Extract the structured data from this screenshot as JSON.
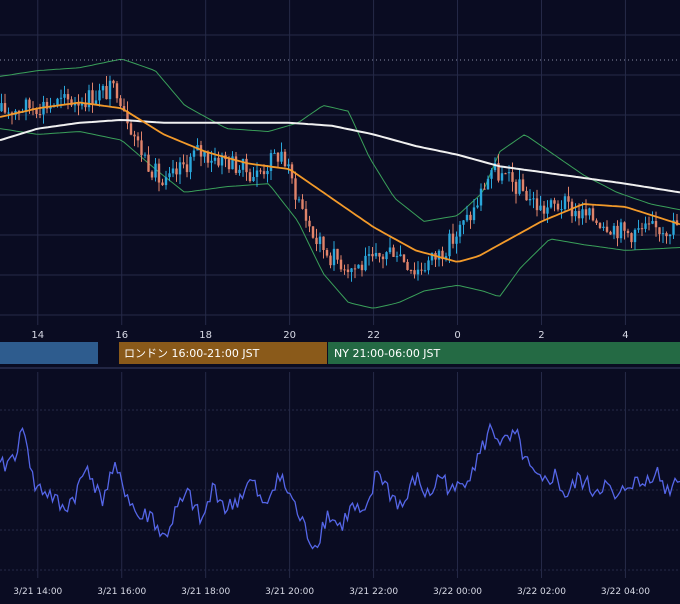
{
  "colors": {
    "background": "#0a0c22",
    "grid": "#262a48",
    "candle_up": "#2aa7dc",
    "candle_down": "#e0836a",
    "ma_fast": "#f39a2a",
    "ma_slow": "#f0f0f0",
    "bollinger": "#3aa05a",
    "oscillator": "#5566e8",
    "session_tokyo": "#2e5c8e",
    "session_london": "#8a5a1a",
    "session_ny": "#246a44"
  },
  "sessions": [
    {
      "id": "tokyo",
      "label": ""
    },
    {
      "id": "london",
      "label": "ロンドン 16:00-21:00 JST"
    },
    {
      "id": "ny",
      "label": "NY 21:00-06:00 JST"
    }
  ],
  "chart_data": [
    {
      "type": "candlestick",
      "x_ticks": [
        "14",
        "16",
        "18",
        "20",
        "22",
        "0",
        "2",
        "4"
      ],
      "x_tick_hours": [
        14,
        16,
        18,
        20,
        22,
        24,
        26,
        28
      ],
      "x_range_hours": [
        13.1,
        29.3
      ],
      "overlays": [
        "ma_fast",
        "ma_slow",
        "bollinger_upper",
        "bollinger_lower"
      ],
      "price_path": [
        [
          13.1,
          0.72
        ],
        [
          14.0,
          0.74
        ],
        [
          15.0,
          0.76
        ],
        [
          15.9,
          0.8
        ],
        [
          16.4,
          0.6
        ],
        [
          17.0,
          0.46
        ],
        [
          17.8,
          0.58
        ],
        [
          18.5,
          0.55
        ],
        [
          19.2,
          0.5
        ],
        [
          19.8,
          0.58
        ],
        [
          20.2,
          0.42
        ],
        [
          20.6,
          0.28
        ],
        [
          21.0,
          0.22
        ],
        [
          21.5,
          0.18
        ],
        [
          22.0,
          0.2
        ],
        [
          22.5,
          0.25
        ],
        [
          23.0,
          0.17
        ],
        [
          23.5,
          0.22
        ],
        [
          23.9,
          0.28
        ],
        [
          24.4,
          0.38
        ],
        [
          24.8,
          0.52
        ],
        [
          25.2,
          0.48
        ],
        [
          25.6,
          0.44
        ],
        [
          26.0,
          0.38
        ],
        [
          26.5,
          0.4
        ],
        [
          27.0,
          0.36
        ],
        [
          27.5,
          0.34
        ],
        [
          28.0,
          0.3
        ],
        [
          28.6,
          0.31
        ],
        [
          29.3,
          0.33
        ]
      ],
      "ma_fast": [
        [
          13.1,
          0.7
        ],
        [
          14.0,
          0.73
        ],
        [
          15.0,
          0.75
        ],
        [
          16.0,
          0.73
        ],
        [
          17.0,
          0.64
        ],
        [
          18.0,
          0.58
        ],
        [
          19.0,
          0.54
        ],
        [
          20.0,
          0.52
        ],
        [
          21.0,
          0.42
        ],
        [
          22.0,
          0.32
        ],
        [
          23.0,
          0.24
        ],
        [
          24.0,
          0.2
        ],
        [
          24.5,
          0.22
        ],
        [
          25.0,
          0.26
        ],
        [
          26.0,
          0.34
        ],
        [
          27.0,
          0.4
        ],
        [
          28.0,
          0.39
        ],
        [
          29.3,
          0.33
        ]
      ],
      "ma_slow": [
        [
          13.1,
          0.62
        ],
        [
          14.0,
          0.66
        ],
        [
          15.0,
          0.68
        ],
        [
          16.0,
          0.69
        ],
        [
          17.0,
          0.68
        ],
        [
          18.0,
          0.68
        ],
        [
          19.0,
          0.68
        ],
        [
          20.0,
          0.68
        ],
        [
          21.0,
          0.67
        ],
        [
          22.0,
          0.64
        ],
        [
          23.0,
          0.6
        ],
        [
          24.0,
          0.57
        ],
        [
          25.0,
          0.53
        ],
        [
          26.0,
          0.51
        ],
        [
          27.0,
          0.49
        ],
        [
          28.0,
          0.47
        ],
        [
          29.3,
          0.44
        ]
      ],
      "bollinger_upper": [
        [
          13.1,
          0.84
        ],
        [
          14.0,
          0.86
        ],
        [
          15.0,
          0.87
        ],
        [
          16.0,
          0.9
        ],
        [
          16.8,
          0.86
        ],
        [
          17.5,
          0.74
        ],
        [
          18.5,
          0.66
        ],
        [
          19.5,
          0.65
        ],
        [
          20.2,
          0.68
        ],
        [
          20.8,
          0.74
        ],
        [
          21.4,
          0.72
        ],
        [
          21.9,
          0.56
        ],
        [
          22.5,
          0.42
        ],
        [
          23.2,
          0.34
        ],
        [
          24.0,
          0.36
        ],
        [
          24.6,
          0.44
        ],
        [
          25.0,
          0.58
        ],
        [
          25.6,
          0.64
        ],
        [
          26.2,
          0.58
        ],
        [
          27.0,
          0.5
        ],
        [
          27.8,
          0.44
        ],
        [
          28.6,
          0.4
        ],
        [
          29.3,
          0.38
        ]
      ],
      "bollinger_lower": [
        [
          13.1,
          0.66
        ],
        [
          14.0,
          0.64
        ],
        [
          15.0,
          0.65
        ],
        [
          16.0,
          0.62
        ],
        [
          16.8,
          0.52
        ],
        [
          17.5,
          0.44
        ],
        [
          18.5,
          0.46
        ],
        [
          19.5,
          0.47
        ],
        [
          20.2,
          0.34
        ],
        [
          20.8,
          0.16
        ],
        [
          21.4,
          0.06
        ],
        [
          22.0,
          0.04
        ],
        [
          22.6,
          0.06
        ],
        [
          23.2,
          0.1
        ],
        [
          24.0,
          0.12
        ],
        [
          24.6,
          0.1
        ],
        [
          25.0,
          0.08
        ],
        [
          25.5,
          0.18
        ],
        [
          26.2,
          0.28
        ],
        [
          27.0,
          0.26
        ],
        [
          28.0,
          0.24
        ],
        [
          29.3,
          0.25
        ]
      ]
    },
    {
      "type": "line",
      "x_ticks": [
        "3/21 14:00",
        "3/21 16:00",
        "3/21 18:00",
        "3/21 20:00",
        "3/21 22:00",
        "3/22 00:00",
        "3/22 02:00",
        "3/22 04:00"
      ],
      "x_tick_hours": [
        14,
        16,
        18,
        20,
        22,
        24,
        26,
        28
      ],
      "x_range_hours": [
        13.1,
        29.3
      ],
      "series": [
        {
          "values": [
            [
              13.1,
              0.55
            ],
            [
              13.4,
              0.62
            ],
            [
              13.7,
              0.8
            ],
            [
              13.9,
              0.45
            ],
            [
              14.3,
              0.4
            ],
            [
              14.6,
              0.3
            ],
            [
              14.9,
              0.4
            ],
            [
              15.2,
              0.58
            ],
            [
              15.5,
              0.35
            ],
            [
              15.8,
              0.55
            ],
            [
              16.1,
              0.42
            ],
            [
              16.4,
              0.25
            ],
            [
              16.7,
              0.28
            ],
            [
              17.0,
              0.12
            ],
            [
              17.3,
              0.3
            ],
            [
              17.6,
              0.4
            ],
            [
              17.9,
              0.22
            ],
            [
              18.2,
              0.45
            ],
            [
              18.5,
              0.3
            ],
            [
              18.8,
              0.38
            ],
            [
              19.1,
              0.48
            ],
            [
              19.4,
              0.3
            ],
            [
              19.7,
              0.52
            ],
            [
              20.0,
              0.4
            ],
            [
              20.3,
              0.22
            ],
            [
              20.6,
              0.08
            ],
            [
              20.9,
              0.28
            ],
            [
              21.2,
              0.2
            ],
            [
              21.5,
              0.32
            ],
            [
              21.8,
              0.25
            ],
            [
              22.1,
              0.55
            ],
            [
              22.4,
              0.4
            ],
            [
              22.7,
              0.32
            ],
            [
              23.0,
              0.5
            ],
            [
              23.3,
              0.38
            ],
            [
              23.6,
              0.52
            ],
            [
              23.9,
              0.4
            ],
            [
              24.2,
              0.5
            ],
            [
              24.5,
              0.62
            ],
            [
              24.8,
              0.8
            ],
            [
              25.1,
              0.7
            ],
            [
              25.4,
              0.75
            ],
            [
              25.7,
              0.55
            ],
            [
              26.0,
              0.45
            ],
            [
              26.3,
              0.52
            ],
            [
              26.6,
              0.38
            ],
            [
              26.9,
              0.5
            ],
            [
              27.2,
              0.42
            ],
            [
              27.5,
              0.46
            ],
            [
              27.8,
              0.35
            ],
            [
              28.1,
              0.48
            ],
            [
              28.4,
              0.45
            ],
            [
              28.7,
              0.55
            ],
            [
              29.0,
              0.42
            ],
            [
              29.3,
              0.52
            ]
          ]
        }
      ]
    }
  ]
}
